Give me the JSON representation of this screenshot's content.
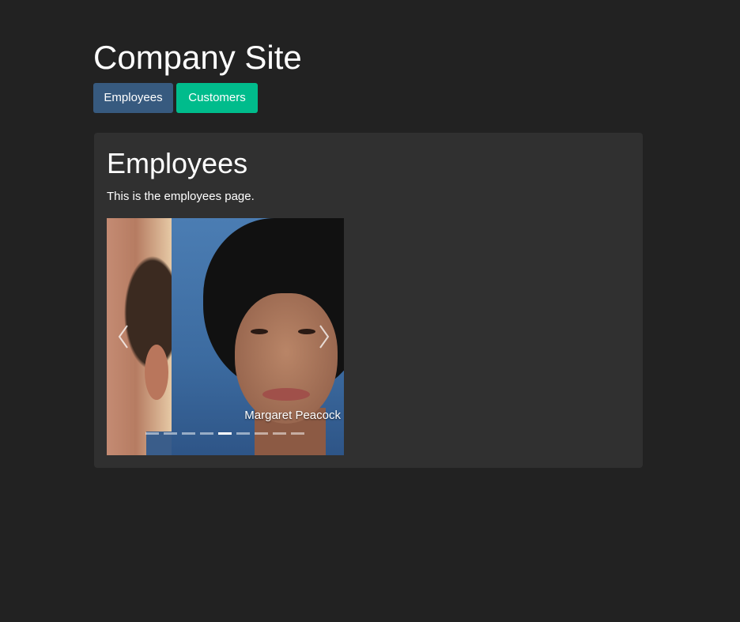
{
  "site": {
    "title": "Company Site"
  },
  "nav": {
    "employees_label": "Employees",
    "customers_label": "Customers"
  },
  "panel": {
    "title": "Employees",
    "text": "This is the employees page."
  },
  "carousel": {
    "caption": "Margaret Peacock",
    "slide_count": 9,
    "active_index": 4,
    "prev_icon": "chevron-left-icon",
    "next_icon": "chevron-right-icon"
  },
  "colors": {
    "background": "#222222",
    "panel": "#303030",
    "primary": "#375a7f",
    "success": "#00bc8c"
  }
}
